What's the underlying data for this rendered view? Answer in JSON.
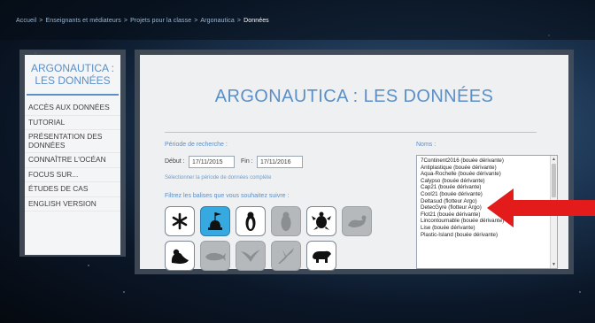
{
  "breadcrumb": {
    "items": [
      "Accueil",
      "Enseignants et médiateurs",
      "Projets pour la classe",
      "Argonautica"
    ],
    "separator": ">",
    "current": "Données"
  },
  "sidebar": {
    "title": "ARGONAUTICA : LES DONNÉES",
    "items": [
      {
        "label": "ACCÈS AUX DONNÉES"
      },
      {
        "label": "TUTORIAL"
      },
      {
        "label": "PRÉSENTATION DES DONNÉES"
      },
      {
        "label": "CONNAÎTRE L'OCÉAN"
      },
      {
        "label": "FOCUS SUR..."
      },
      {
        "label": "ÉTUDES DE CAS"
      },
      {
        "label": "ENGLISH VERSION"
      }
    ]
  },
  "main": {
    "title": "ARGONAUTICA : LES DONNÉES",
    "period": {
      "label": "Période de recherche :",
      "start_label": "Début :",
      "start_value": "17/11/2015",
      "end_label": "Fin :",
      "end_value": "17/11/2016",
      "full_period_link": "Sélectionner la période de données complète"
    },
    "filter": {
      "label": "Filtrez les balises que vous souhaitez suivre :",
      "tags": [
        {
          "icon": "asterisk-icon",
          "state": "normal"
        },
        {
          "icon": "buoy-icon",
          "state": "selected"
        },
        {
          "icon": "penguin-icon",
          "state": "normal"
        },
        {
          "icon": "penguin-icon",
          "state": "disabled"
        },
        {
          "icon": "turtle-icon",
          "state": "normal"
        },
        {
          "icon": "seal-icon",
          "state": "disabled"
        },
        {
          "icon": "sea-lion-icon",
          "state": "normal"
        },
        {
          "icon": "whale-icon",
          "state": "disabled"
        },
        {
          "icon": "bird-icon",
          "state": "disabled"
        },
        {
          "icon": "albatross-icon",
          "state": "disabled"
        },
        {
          "icon": "polar-bear-icon",
          "state": "normal"
        }
      ]
    },
    "names": {
      "label": "Noms :",
      "items": [
        "7Continent2016 (bouée dérivante)",
        "Antiplastique (bouée dérivante)",
        "Aqua-Rochelle (bouée dérivante)",
        "Calypso (bouée dérivante)",
        "Cap21 (bouée dérivante)",
        "Cool21 (bouée dérivante)",
        "Deltasud (flotteur Argo)",
        "DetecGyre (flotteur Argo)",
        "Flot21 (bouée dérivante)",
        "Lincontournable (bouée dérivante)",
        "Lise (bouée dérivante)",
        "Plastic-Island (bouée dérivante)"
      ]
    }
  },
  "colors": {
    "accent": "#5b8fc7",
    "selected_tag": "#36a9e1",
    "disabled_tag": "#b6b9bc",
    "arrow": "#e41b1b"
  }
}
